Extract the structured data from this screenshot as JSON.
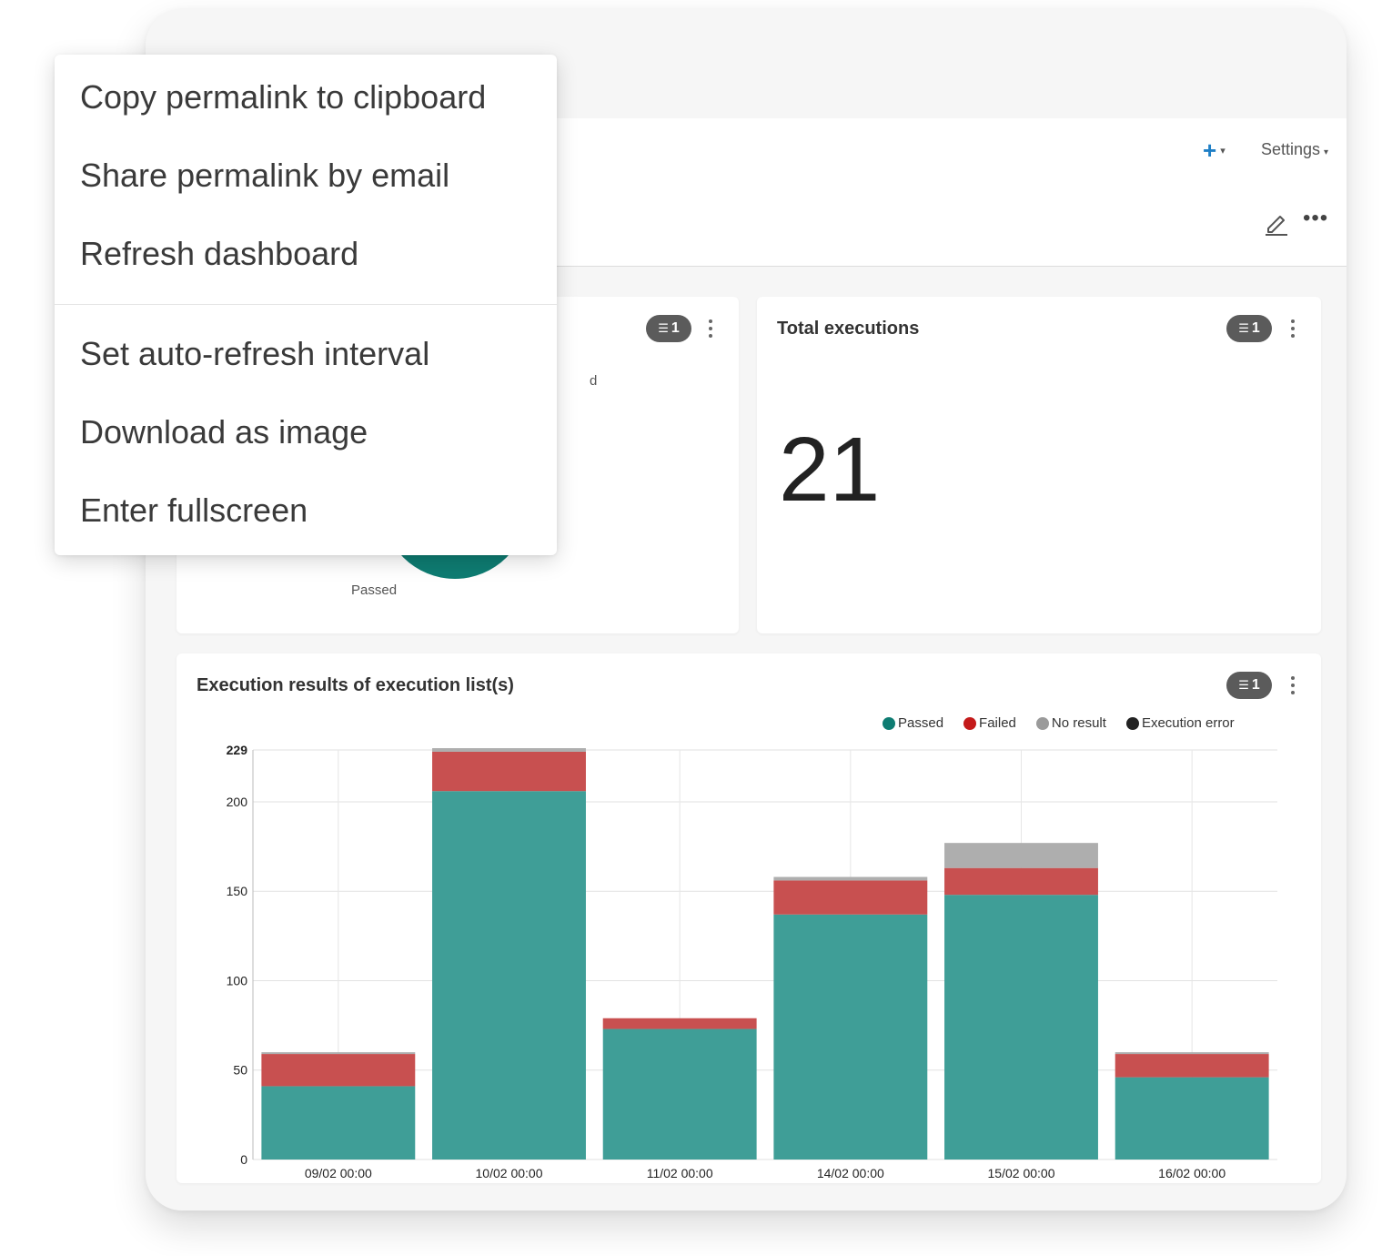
{
  "toolbar": {
    "add_icon": "plus-icon",
    "settings_label": "Settings"
  },
  "header": {
    "edit_icon": "pencil-icon",
    "more_icon": "more-horizontal-icon"
  },
  "pie_card": {
    "filter_count": "1",
    "label_passed": "Passed",
    "label_partial": "d",
    "passed_color": "#0e7c72"
  },
  "total_card": {
    "title": "Total executions",
    "filter_count": "1",
    "value": "21"
  },
  "results_card": {
    "title": "Execution results of execution list(s)",
    "filter_count": "1"
  },
  "chart_data": {
    "type": "bar",
    "stacked": true,
    "title": "Execution results of execution list(s)",
    "categories": [
      "09/02 00:00",
      "10/02 00:00",
      "11/02 00:00",
      "14/02 00:00",
      "15/02 00:00",
      "16/02 00:00"
    ],
    "series": [
      {
        "name": "Passed",
        "color": "#3f9e97",
        "legend_color": "#0e7c72",
        "values": [
          41,
          206,
          73,
          137,
          148,
          46
        ]
      },
      {
        "name": "Failed",
        "color": "#c85050",
        "legend_color": "#c41a1a",
        "values": [
          18,
          22,
          6,
          19,
          15,
          13
        ]
      },
      {
        "name": "No result",
        "color": "#aeaeae",
        "legend_color": "#9a9a9a",
        "values": [
          1,
          2,
          0,
          2,
          14,
          1
        ]
      },
      {
        "name": "Execution error",
        "color": "#222222",
        "legend_color": "#222222",
        "values": [
          0,
          0,
          0,
          0,
          0,
          0
        ]
      }
    ],
    "y_ticks": [
      "0",
      "50",
      "100",
      "150",
      "200",
      "229"
    ],
    "ylim": [
      0,
      229
    ],
    "grid": true,
    "legend_position": "top-right"
  },
  "menu": {
    "items": [
      "Copy permalink to clipboard",
      "Share permalink by email",
      "Refresh dashboard",
      "Set auto-refresh interval",
      "Download as image",
      "Enter fullscreen"
    ]
  }
}
